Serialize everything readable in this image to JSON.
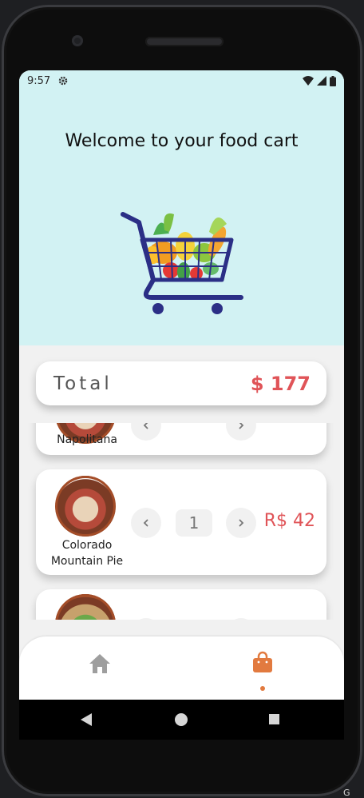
{
  "status_bar": {
    "time": "9:57"
  },
  "header": {
    "title": "Welcome to your food cart"
  },
  "total": {
    "label": "Total",
    "value": "$ 177"
  },
  "cart_items": [
    {
      "name": "Napolitana",
      "quantity": "",
      "price": ""
    },
    {
      "name": "Colorado Mountain Pie",
      "quantity": "1",
      "price": "R$ 42"
    },
    {
      "name": "",
      "quantity": "",
      "price": ""
    }
  ],
  "bottom_nav": {
    "items": [
      "home-icon",
      "shopping-bag-icon"
    ],
    "active": "shopping-bag-icon"
  },
  "colors": {
    "hero_bg": "#d2f2f3",
    "accent_red": "#e05458",
    "accent_orange": "#e27a3f",
    "cart_blue": "#2b2f86"
  },
  "corner": {
    "label": "G"
  }
}
